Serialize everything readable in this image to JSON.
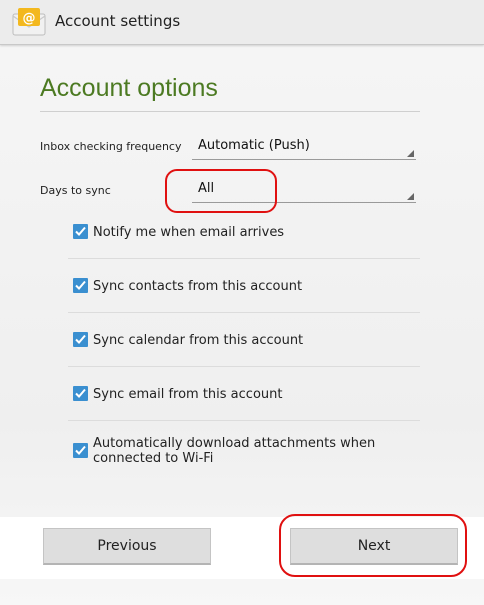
{
  "action_bar": {
    "title": "Account settings",
    "app_icon": "email-app-icon",
    "icon_glyph": "@"
  },
  "section": {
    "heading": "Account options"
  },
  "settings": {
    "inbox_frequency": {
      "label": "Inbox checking frequency",
      "value": "Automatic (Push)"
    },
    "days_to_sync": {
      "label": "Days to sync",
      "value": "All"
    }
  },
  "options": [
    {
      "label": "Notify me when email arrives",
      "checked": true
    },
    {
      "label": "Sync contacts from this account",
      "checked": true
    },
    {
      "label": "Sync calendar from this account",
      "checked": true
    },
    {
      "label": "Sync email from this account",
      "checked": true
    },
    {
      "label": "Automatically download attachments when connected to Wi-Fi",
      "checked": true
    }
  ],
  "buttons": {
    "previous": "Previous",
    "next": "Next"
  },
  "colors": {
    "heading": "#4c7a22",
    "checkbox": "#3a8fd0",
    "annotation": "#e01010"
  }
}
